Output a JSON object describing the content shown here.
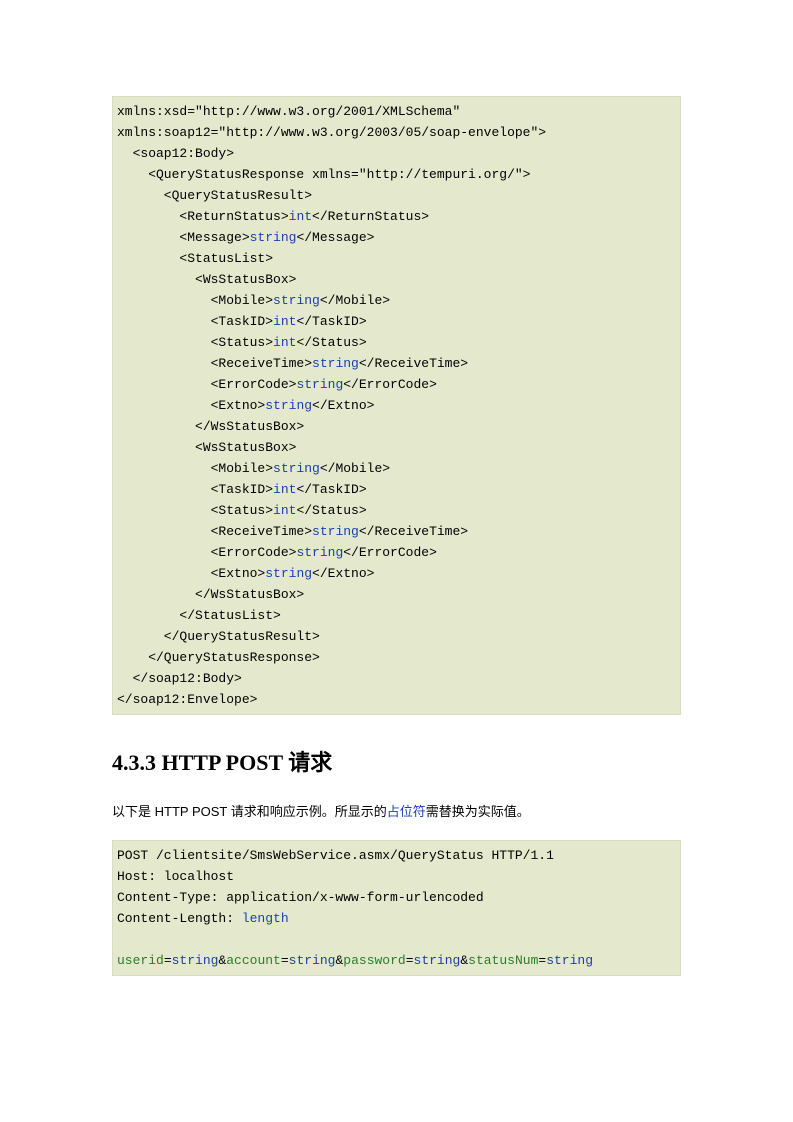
{
  "code1": {
    "l1": "xmlns:xsd=\"http://www.w3.org/2001/XMLSchema\" ",
    "l2": "xmlns:soap12=\"http://www.w3.org/2003/05/soap-envelope\">",
    "l3": "  <soap12:Body>",
    "l4": "    <QueryStatusResponse xmlns=\"http://tempuri.org/\">",
    "l5": "      <QueryStatusResult>",
    "l6a": "        <ReturnStatus>",
    "l6b": "int",
    "l6c": "</ReturnStatus>",
    "l7a": "        <Message>",
    "l7b": "string",
    "l7c": "</Message>",
    "l8": "        <StatusList>",
    "l9": "          <WsStatusBox>",
    "l10a": "            <Mobile>",
    "l10b": "string",
    "l10c": "</Mobile>",
    "l11a": "            <TaskID>",
    "l11b": "int",
    "l11c": "</TaskID>",
    "l12a": "            <Status>",
    "l12b": "int",
    "l12c": "</Status>",
    "l13a": "            <ReceiveTime>",
    "l13b": "string",
    "l13c": "</ReceiveTime>",
    "l14a": "            <ErrorCode>",
    "l14b": "string",
    "l14c": "</ErrorCode>",
    "l15a": "            <Extno>",
    "l15b": "string",
    "l15c": "</Extno>",
    "l16": "          </WsStatusBox>",
    "l17": "          <WsStatusBox>",
    "l18a": "            <Mobile>",
    "l18b": "string",
    "l18c": "</Mobile>",
    "l19a": "            <TaskID>",
    "l19b": "int",
    "l19c": "</TaskID>",
    "l20a": "            <Status>",
    "l20b": "int",
    "l20c": "</Status>",
    "l21a": "            <ReceiveTime>",
    "l21b": "string",
    "l21c": "</ReceiveTime>",
    "l22a": "            <ErrorCode>",
    "l22b": "string",
    "l22c": "</ErrorCode>",
    "l23a": "            <Extno>",
    "l23b": "string",
    "l23c": "</Extno>",
    "l24": "          </WsStatusBox>",
    "l25": "        </StatusList>",
    "l26": "      </QueryStatusResult>",
    "l27": "    </QueryStatusResponse>",
    "l28": "  </soap12:Body>",
    "l29": "</soap12:Envelope>"
  },
  "heading": "4.3.3  HTTP POST 请求",
  "desc": {
    "pre": "以下是 ",
    "bold": "HTTP POST",
    "mid": " 请求和响应示例。所显示的",
    "link": "占位符",
    "post": "需替换为实际值。"
  },
  "code2": {
    "l1": "POST /clientsite/SmsWebService.asmx/QueryStatus HTTP/1.1",
    "l2": "Host: localhost",
    "l3": "Content-Type: application/x-www-form-urlencoded",
    "l4a": "Content-Length: ",
    "l4b": "length",
    "blank": "",
    "p1": "userid",
    "p2": "account",
    "p3": "password",
    "p4": "statusNum",
    "eq": "=",
    "amp": "&",
    "val": "string"
  }
}
